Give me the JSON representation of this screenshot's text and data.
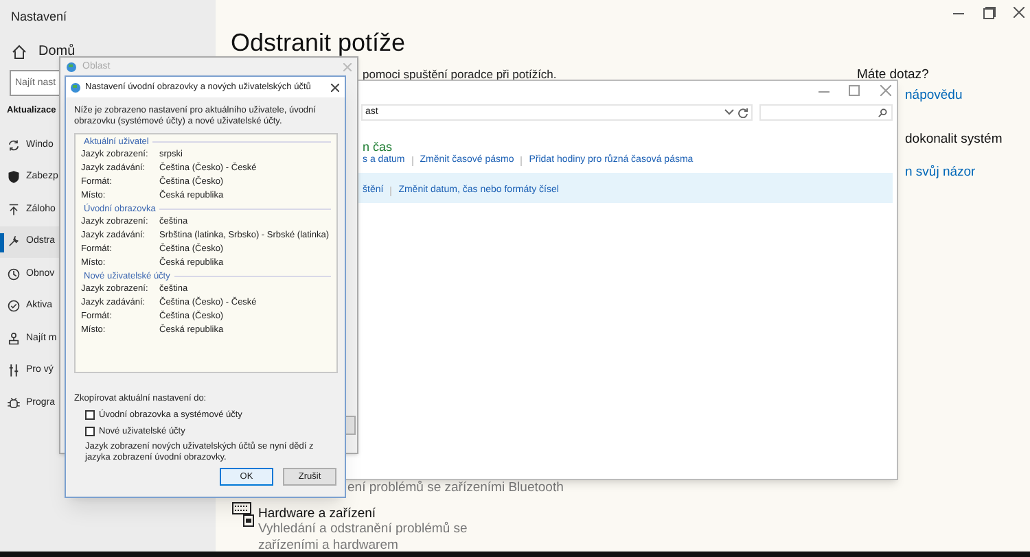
{
  "settings": {
    "title": "Nastavení",
    "home": "Domů",
    "search": {
      "placeholder": "Najít nast"
    },
    "section": "Aktualizace",
    "nav": [
      {
        "label": "Windo",
        "selected": false
      },
      {
        "label": "Zabezp",
        "selected": false
      },
      {
        "label": "Záloho",
        "selected": false
      },
      {
        "label": "Odstra",
        "selected": true
      },
      {
        "label": "Obnov",
        "selected": false
      },
      {
        "label": "Aktiva",
        "selected": false
      },
      {
        "label": "Najít m",
        "selected": false
      },
      {
        "label": "Pro vý",
        "selected": false
      },
      {
        "label": "Progra",
        "selected": false
      }
    ],
    "heading": "Odstranit potíže",
    "intro": "pomoci spuštění poradce při potížích.",
    "side": [
      {
        "kind": "heading",
        "text": "Máte dotaz?"
      },
      {
        "kind": "link",
        "text": "nápovědu"
      },
      {
        "kind": "heading",
        "text": "dokonalit systém"
      },
      {
        "kind": "link",
        "text": "n svůj názor"
      }
    ],
    "bluetooth_desc": "ení problémů se zařízeními Bluetooth",
    "hardware": {
      "title": "Hardware a zařízení",
      "desc": "Vyhledání a odstranění problémů se zařízeními a hardwarem"
    }
  },
  "control_panel": {
    "address": "ast",
    "category": "n čas",
    "links": [
      "s a datum",
      "Změnit časové pásmo",
      "Přidat hodiny pro různá časová pásma"
    ],
    "links2": [
      "štění",
      "Změnit datum, čas nebo formáty čísel"
    ]
  },
  "region_dialog": {
    "title": "Oblast"
  },
  "dialog": {
    "title": "Nastavení úvodní obrazovky a nových uživatelských účtů",
    "description": "Níže je zobrazeno nastavení pro aktuálního uživatele, úvodní obrazovku (systémové účty) a nové uživatelské účty.",
    "groups": [
      {
        "title": "Aktuální uživatel",
        "rows": [
          [
            "Jazyk zobrazení:",
            "srpski"
          ],
          [
            "Jazyk zadávání:",
            "Čeština (Česko) - České"
          ],
          [
            "Formát:",
            "Čeština (Česko)"
          ],
          [
            "Místo:",
            "Česká republika"
          ]
        ]
      },
      {
        "title": "Úvodní obrazovka",
        "rows": [
          [
            "Jazyk zobrazení:",
            "čeština"
          ],
          [
            "Jazyk zadávání:",
            "Srbština (latinka, Srbsko) - Srbské (latinka)"
          ],
          [
            "Formát:",
            "Čeština (Česko)"
          ],
          [
            "Místo:",
            "Česká republika"
          ]
        ]
      },
      {
        "title": "Nové uživatelské účty",
        "rows": [
          [
            "Jazyk zobrazení:",
            "čeština"
          ],
          [
            "Jazyk zadávání:",
            "Čeština (Česko) - České"
          ],
          [
            "Formát:",
            "Čeština (Česko)"
          ],
          [
            "Místo:",
            "Česká republika"
          ]
        ]
      }
    ],
    "copy_label": "Zkopírovat aktuální nastavení do:",
    "options": [
      {
        "label": "Úvodní obrazovka a systémové účty",
        "checked": false
      },
      {
        "label": "Nové uživatelské účty",
        "checked": false
      }
    ],
    "note": "Jazyk zobrazení nových uživatelských účtů se nyní dědí z jazyka zobrazení úvodní obrazovky.",
    "buttons": [
      {
        "label": "OK",
        "default": true
      },
      {
        "label": "Zrušit",
        "default": false
      }
    ]
  }
}
